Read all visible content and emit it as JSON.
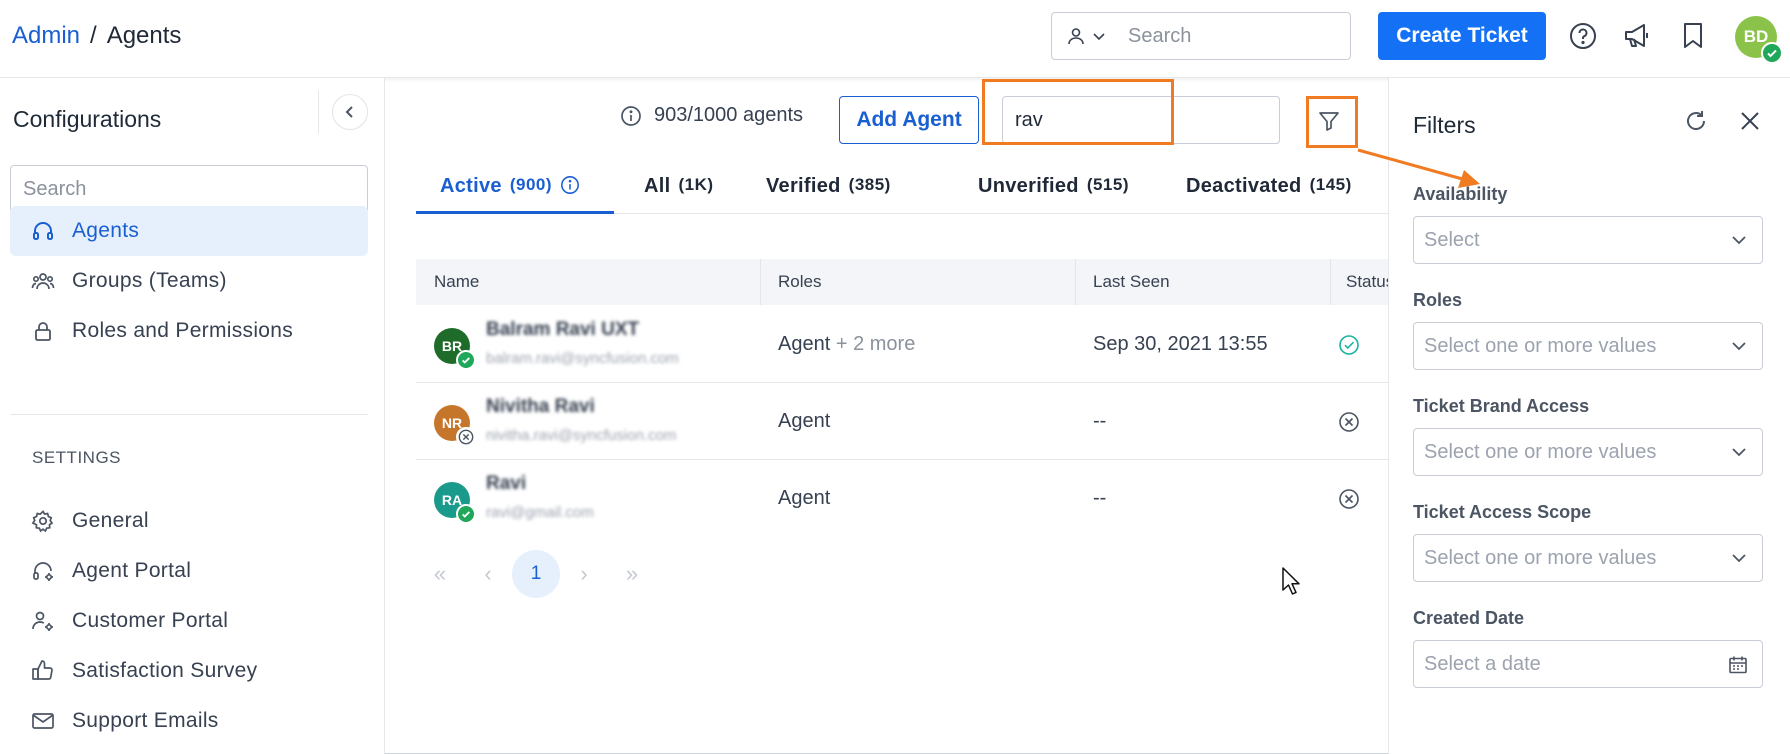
{
  "header": {
    "breadcrumb_link": "Admin",
    "breadcrumb_sep": "/",
    "breadcrumb_current": "Agents",
    "search_placeholder": "Search",
    "create_ticket": "Create Ticket",
    "avatar_initials": "BD"
  },
  "sidebar": {
    "title": "Configurations",
    "search_placeholder": "Search",
    "items": [
      {
        "label": "Agents",
        "icon": "headset-icon"
      },
      {
        "label": "Groups (Teams)",
        "icon": "users-icon"
      },
      {
        "label": "Roles and Permissions",
        "icon": "lock-icon"
      }
    ],
    "settings_label": "SETTINGS",
    "settings_items": [
      {
        "label": "General",
        "icon": "gear-icon"
      },
      {
        "label": "Agent Portal",
        "icon": "headset-gear-icon"
      },
      {
        "label": "Customer Portal",
        "icon": "user-gear-icon"
      },
      {
        "label": "Satisfaction Survey",
        "icon": "thumbs-up-icon"
      },
      {
        "label": "Support Emails",
        "icon": "mail-icon"
      }
    ]
  },
  "main": {
    "count": "903/1000 agents",
    "add_agent": "Add Agent",
    "search_value": "rav",
    "tabs": [
      {
        "label": "Active",
        "count": "(900)"
      },
      {
        "label": "All",
        "count": "(1K)"
      },
      {
        "label": "Verified",
        "count": "(385)"
      },
      {
        "label": "Unverified",
        "count": "(515)"
      },
      {
        "label": "Deactivated",
        "count": "(145)"
      }
    ],
    "columns": [
      "Name",
      "Roles",
      "Last Seen",
      "Status"
    ],
    "rows": [
      {
        "initials": "BR",
        "name": "Balram Ravi UXT",
        "email": "balram.ravi@syncfusion.com",
        "role": "Agent",
        "role_more": "+ 2 more",
        "last_seen": "Sep 30, 2021 13:55",
        "avatar_color": "#1f6b2a",
        "verified": "yes"
      },
      {
        "initials": "NR",
        "name": "Nivitha Ravi",
        "email": "nivitha.ravi@syncfusion.com",
        "role": "Agent",
        "role_more": "",
        "last_seen": "--",
        "avatar_color": "#c6762a",
        "verified": "no"
      },
      {
        "initials": "RA",
        "name": "Ravi",
        "email": "ravi@gmail.com",
        "role": "Agent",
        "role_more": "",
        "last_seen": "--",
        "avatar_color": "#1a9a8a",
        "verified": "yes"
      }
    ],
    "pager": {
      "first": "«",
      "prev": "‹",
      "current": "1",
      "next": "›",
      "last": "»"
    }
  },
  "filters": {
    "title": "Filters",
    "fields": [
      {
        "label": "Availability",
        "placeholder": "Select"
      },
      {
        "label": "Roles",
        "placeholder": "Select one or more values"
      },
      {
        "label": "Ticket Brand Access",
        "placeholder": "Select one or more values"
      },
      {
        "label": "Ticket Access Scope",
        "placeholder": "Select one or more values"
      },
      {
        "label": "Created Date",
        "placeholder": "Select a date"
      }
    ]
  },
  "colors": {
    "accent": "#1a5fd1",
    "primary_button": "#1471f5",
    "highlight": "#f07b22",
    "success": "#1fa85a"
  }
}
